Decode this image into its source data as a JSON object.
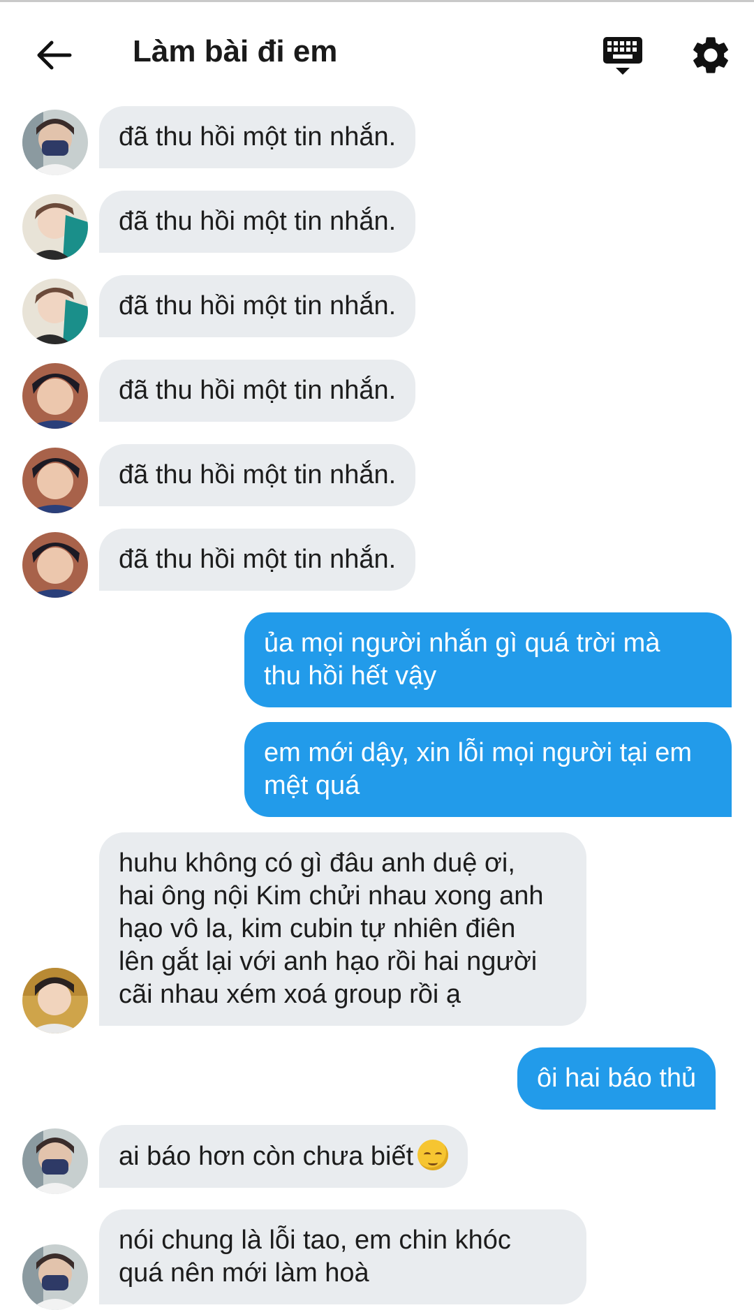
{
  "header": {
    "title": "Làm bài đi em",
    "back_icon": "arrow-left-icon",
    "keyboard_icon": "keyboard-hide-icon",
    "settings_icon": "gear-icon"
  },
  "colors": {
    "incoming_bubble": "#e9ecef",
    "outgoing_bubble": "#229bea",
    "outgoing_text": "#ffffff",
    "incoming_text": "#1c1c1c"
  },
  "messages": [
    {
      "direction": "incoming",
      "avatar": "avatar-masked-boy",
      "lines": [
        "đã thu hồi một tin nhắn."
      ]
    },
    {
      "direction": "incoming",
      "avatar": "avatar-teal-hoodie",
      "lines": [
        "đã thu hồi một tin nhắn."
      ]
    },
    {
      "direction": "incoming",
      "avatar": "avatar-teal-hoodie",
      "lines": [
        "đã thu hồi một tin nhắn."
      ]
    },
    {
      "direction": "incoming",
      "avatar": "avatar-dark-hair",
      "lines": [
        "đã thu hồi một tin nhắn."
      ]
    },
    {
      "direction": "incoming",
      "avatar": "avatar-dark-hair",
      "lines": [
        "đã thu hồi một tin nhắn."
      ]
    },
    {
      "direction": "incoming",
      "avatar": "avatar-dark-hair",
      "lines": [
        "đã thu hồi một tin nhắn."
      ]
    },
    {
      "direction": "outgoing",
      "lines": [
        "ủa mọi người nhắn gì quá trời mà",
        "thu hồi hết vậy"
      ]
    },
    {
      "direction": "outgoing",
      "lines": [
        "em mới dậy, xin lỗi mọi người tại em",
        "mệt quá"
      ]
    },
    {
      "direction": "incoming",
      "avatar": "avatar-selfie-boy",
      "lines": [
        "huhu không có gì đâu anh duệ ơi,",
        "hai ông nội Kim chửi nhau xong anh",
        "hạo vô la, kim cubin tự nhiên điên",
        "lên gắt lại với anh hạo rồi hai người",
        "cãi nhau xém xoá group rồi ạ"
      ]
    },
    {
      "direction": "outgoing",
      "lines": [
        "ôi hai báo thủ"
      ]
    },
    {
      "direction": "incoming",
      "avatar": "avatar-masked-boy",
      "lines": [
        "ai báo hơn còn chưa biết"
      ],
      "emoji": "relieved-face-emoji"
    },
    {
      "direction": "incoming",
      "avatar": "avatar-masked-boy",
      "lines": [
        "nói chung là lỗi tao, em chin khóc",
        "quá nên mới làm hoà"
      ]
    }
  ]
}
